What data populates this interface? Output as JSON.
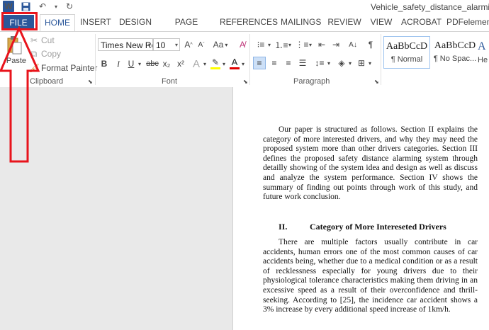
{
  "titlebar": {
    "doc_title": "Vehicle_safety_distance_alarming_s",
    "icons": [
      "word-logo",
      "save-icon",
      "undo-icon",
      "redo-icon"
    ]
  },
  "tabs": [
    "FILE",
    "HOME",
    "INSERT",
    "DESIGN",
    "PAGE LAYOUT",
    "REFERENCES",
    "MAILINGS",
    "REVIEW",
    "VIEW",
    "ACROBAT",
    "PDFelemen"
  ],
  "clipboard": {
    "paste": "Paste",
    "cut": "Cut",
    "copy": "Copy",
    "format_painter": "Format Painter",
    "label": "Clipboard"
  },
  "font": {
    "name": "Times New Ro",
    "size": "10",
    "label": "Font",
    "aa": "Aa",
    "bold": "B",
    "italic": "I",
    "underline": "U",
    "strike": "abc",
    "sub": "x₂",
    "sup": "x²",
    "highlight_color": "#ffff00",
    "font_color": "#e00000"
  },
  "paragraph": {
    "label": "Paragraph",
    "pilcrow": "¶"
  },
  "styles": [
    {
      "sample": "AaBbCcD",
      "name": "¶ Normal"
    },
    {
      "sample": "AaBbCcD",
      "name": "¶ No Spac..."
    },
    {
      "sample": "A",
      "name": "He"
    }
  ],
  "document": {
    "para1": "Our paper is structured as follows. Section II explains the category of more interested drivers, and why they may need the proposed system more than other drivers categories. Section III defines the proposed safety distance alarming system through detailly showing of the system idea and design as well as discuss and analyze the system performance. Section IV shows the summary of finding out points through work of this study, and future work conclusion.",
    "heading_num": "II.",
    "heading_text": "Category of More Intereseted Drivers",
    "para2": "There are multiple factors usually contribute in car accidents, human errors one of the most common causes of car accidents being, whether due to a medical condition or as a result of recklessness especially for young drivers due to their physiological tolerance characteristics making them driving in an excessive speed as a result of their overconfidence and thrill-seeking. According to [25], the incidence car accident shows a 3% increase by every additional speed increase of 1km/h."
  },
  "annotation_color": "#e8141c"
}
